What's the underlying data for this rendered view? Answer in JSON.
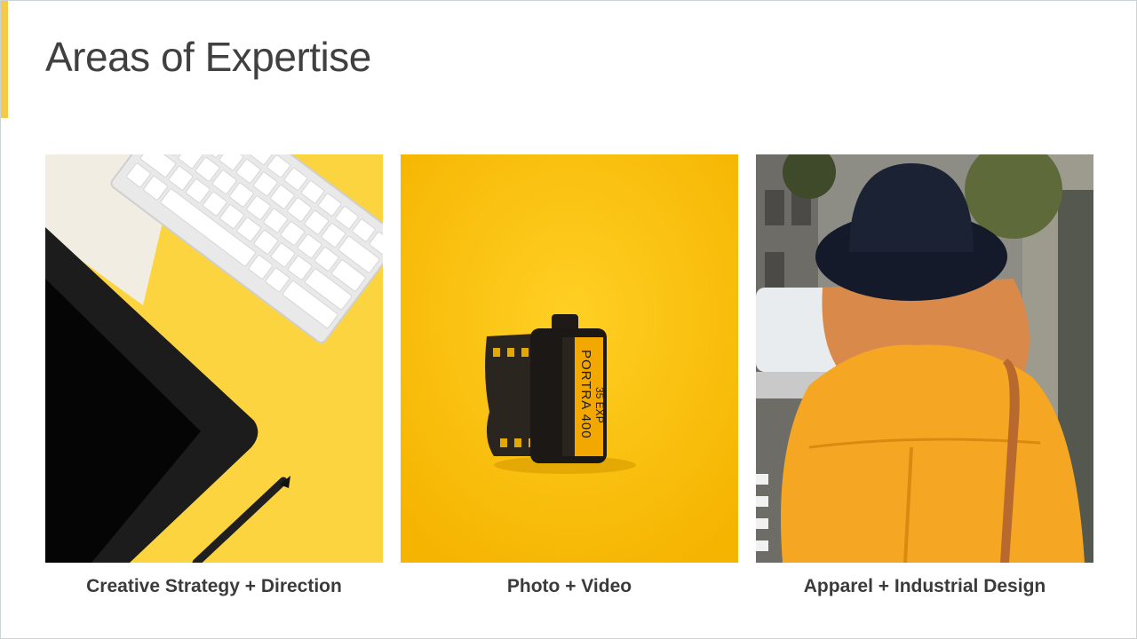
{
  "slide": {
    "title": "Areas of Expertise",
    "accent_color": "#f7c948"
  },
  "cards": [
    {
      "caption": "Creative Strategy + Direction",
      "image": "keyboard-and-tablet-on-yellow-photo"
    },
    {
      "caption": "Photo + Video",
      "image": "film-canister-on-yellow-photo",
      "film_label": "PORTRA 400",
      "film_exp": "35 EXP"
    },
    {
      "caption": "Apparel + Industrial Design",
      "image": "woman-in-yellow-coat-and-hat-photo"
    }
  ]
}
